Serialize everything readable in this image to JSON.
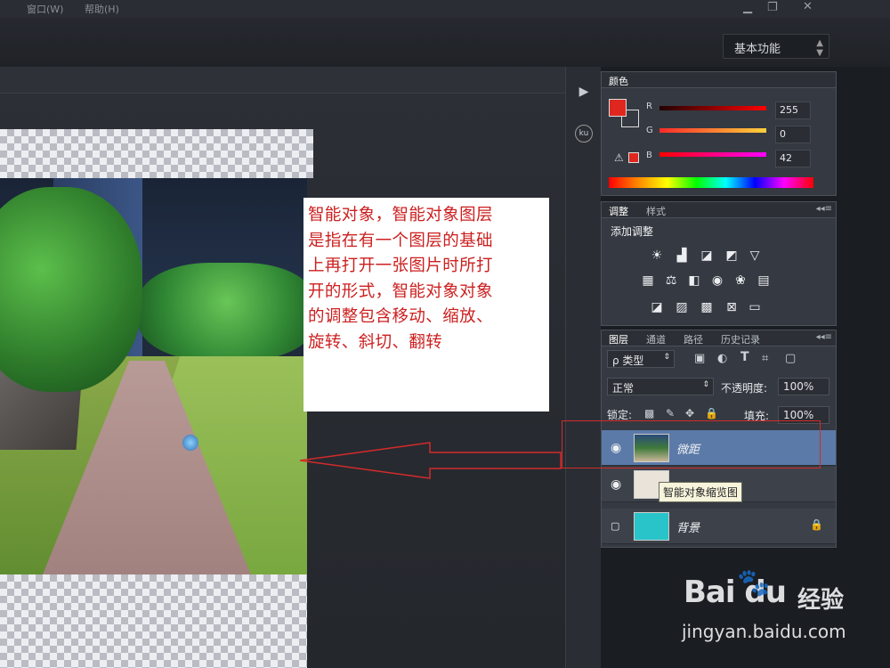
{
  "menubar": {
    "window_menu": "窗口(W)",
    "help_menu": "帮助(H)"
  },
  "workspace": {
    "value": "基本功能"
  },
  "color_panel": {
    "tab": "颜色",
    "r_label": "R",
    "g_label": "G",
    "b_label": "B",
    "r_value": "255",
    "g_value": "0",
    "b_value": "42",
    "foreground_color": "#e0271f"
  },
  "adjust_panel": {
    "tabs": [
      "调整",
      "样式"
    ],
    "title": "添加调整"
  },
  "layers_panel": {
    "tabs": [
      "图层",
      "通道",
      "路径",
      "历史记录"
    ],
    "filter_label": "ρ 类型",
    "blend_mode": "正常",
    "opacity_label": "不透明度:",
    "opacity_value": "100%",
    "lock_label": "锁定:",
    "fill_label": "填充:",
    "fill_value": "100%",
    "layers": [
      {
        "name": "微距",
        "selected": true
      },
      {
        "name": "",
        "selected": false
      },
      {
        "name": "背景",
        "selected": false
      }
    ],
    "tooltip": "智能对象缩览图"
  },
  "callout": {
    "text": "智能对象，智能对象图层\n是指在有一个图层的基础\n上再打开一张图片时所打\n开的形式，智能对象对象\n的调整包含移动、缩放、\n旋转、斜切、翻转"
  },
  "watermark": {
    "brand": "Bai du",
    "product": "经验",
    "url": "jingyan.baidu.com"
  },
  "colors": {
    "accent_red": "#d22b2b",
    "layer_selected": "#5b7aa8",
    "background_layer": "#29c4c9"
  }
}
